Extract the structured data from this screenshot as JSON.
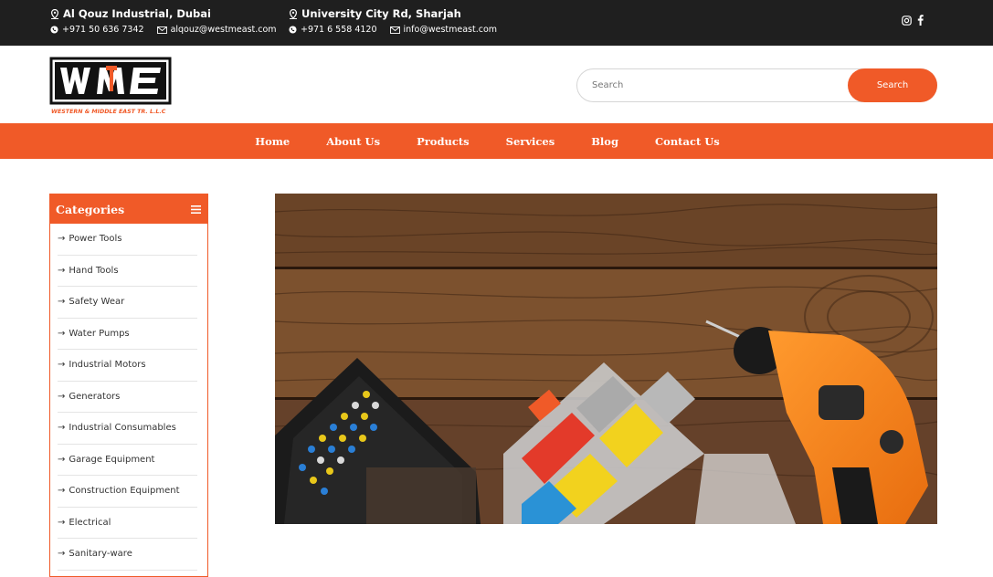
{
  "topbar": {
    "location1": "Al Qouz Industrial, Dubai",
    "phone1": "+971 50 636 7342",
    "email1": "alqouz@westmeast.com",
    "location2": "University City Rd, Sharjah",
    "phone2": "+971 6 558 4120",
    "email2": "info@westmeast.com",
    "social": [
      "instagram-icon",
      "facebook-icon"
    ]
  },
  "logo": {
    "mark": "WME",
    "tagline": "WESTERN & MIDDLE EAST TR. L.L.C"
  },
  "search": {
    "placeholder": "Search",
    "button": "Search"
  },
  "nav": {
    "items": [
      "Home",
      "About Us",
      "Products",
      "Services",
      "Blog",
      "Contact Us"
    ]
  },
  "categories": {
    "title": "Categories",
    "items": [
      "Power Tools",
      "Hand Tools",
      "Safety Wear",
      "Water Pumps",
      "Industrial Motors",
      "Generators",
      "Industrial Consumables",
      "Garage Equipment",
      "Construction Equipment",
      "Electrical",
      "Sanitary-ware"
    ]
  },
  "colors": {
    "accent": "#f05a28",
    "topbar": "#1f1f1f"
  }
}
